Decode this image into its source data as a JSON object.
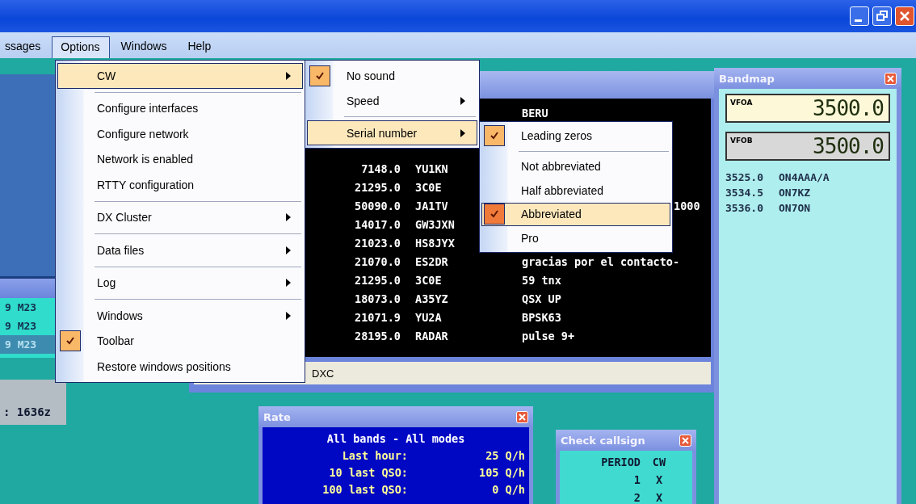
{
  "menu_bar": [
    {
      "label": "ssages",
      "selected": false
    },
    {
      "label": "Options",
      "selected": true
    },
    {
      "label": "Windows",
      "selected": false
    },
    {
      "label": "Help",
      "selected": false
    }
  ],
  "options_menu": [
    {
      "label": "CW",
      "kind": "submenu",
      "checked": false,
      "selected": true
    },
    {
      "kind": "separator"
    },
    {
      "label": "Configure interfaces",
      "kind": "item",
      "checked": false,
      "selected": false
    },
    {
      "label": "Configure network",
      "kind": "item",
      "checked": false,
      "selected": false
    },
    {
      "label": "Network is enabled",
      "kind": "item",
      "checked": false,
      "selected": false
    },
    {
      "label": "RTTY configuration",
      "kind": "item",
      "checked": false,
      "selected": false
    },
    {
      "kind": "separator"
    },
    {
      "label": "DX Cluster",
      "kind": "submenu",
      "checked": false,
      "selected": false
    },
    {
      "kind": "separator"
    },
    {
      "label": "Data files",
      "kind": "submenu",
      "checked": false,
      "selected": false
    },
    {
      "kind": "separator"
    },
    {
      "label": "Log",
      "kind": "submenu",
      "checked": false,
      "selected": false
    },
    {
      "kind": "separator"
    },
    {
      "label": "Windows",
      "kind": "submenu",
      "checked": false,
      "selected": false
    },
    {
      "label": "Toolbar",
      "kind": "item",
      "checked": true,
      "selected": false
    },
    {
      "label": "Restore windows positions",
      "kind": "item",
      "checked": false,
      "selected": false
    }
  ],
  "cw_submenu": [
    {
      "label": "No sound",
      "kind": "item",
      "checked": true,
      "selected": false
    },
    {
      "label": "Speed",
      "kind": "submenu",
      "checked": false,
      "selected": false
    },
    {
      "kind": "separator"
    },
    {
      "label": "Serial number",
      "kind": "submenu",
      "checked": false,
      "selected": true
    }
  ],
  "serial_submenu": [
    {
      "label": "Leading zeros",
      "kind": "item",
      "checked": true,
      "selected": false
    },
    {
      "kind": "separator"
    },
    {
      "label": "Not abbreviated",
      "kind": "item",
      "checked": false,
      "selected": false
    },
    {
      "label": "Half abbreviated",
      "kind": "item",
      "checked": false,
      "selected": false
    },
    {
      "label": "Abbreviated",
      "kind": "item",
      "checked": true,
      "selected": true
    },
    {
      "label": "Pro",
      "kind": "item",
      "checked": false,
      "selected": false
    }
  ],
  "log_window": {
    "rows": [
      {
        "text": "9 M23",
        "selected": false
      },
      {
        "text": "9 M23",
        "selected": false
      },
      {
        "text": "9 M23",
        "selected": true
      }
    ]
  },
  "time_panel": {
    "text": ": 1636z"
  },
  "dx_cluster": {
    "rows": [
      {
        "comment": "BERU"
      },
      {
        "freq": "7148.0",
        "call": "YU1KN"
      },
      {
        "freq": "21295.0",
        "call": "3C0E"
      },
      {
        "freq": "50090.0",
        "call": "JA1TV",
        "trailing": "1000"
      },
      {
        "freq": "14017.0",
        "call": "GW3JXN"
      },
      {
        "freq": "21023.0",
        "call": "HS8JYX"
      },
      {
        "freq": "21070.0",
        "call": "ES2DR",
        "comment": "gracias por el contacto-"
      },
      {
        "freq": "21295.0",
        "call": "3C0E",
        "comment": "59 tnx"
      },
      {
        "freq": "18073.0",
        "call": "A35YZ",
        "comment": "QSX UP"
      },
      {
        "freq": "21071.9",
        "call": "YU2A",
        "comment": "BPSK63"
      },
      {
        "freq": "28195.0",
        "call": "RADAR",
        "comment": "pulse 9+"
      }
    ],
    "status_tab": "DXC"
  },
  "bandmap": {
    "title": "Bandmap",
    "vfos": [
      {
        "label": "VFOA",
        "value": "3500.0",
        "selected": true
      },
      {
        "label": "VFOB",
        "value": "3500.0",
        "selected": false
      }
    ],
    "spots": [
      {
        "freq": "3525.0",
        "call": "ON4AAA/A"
      },
      {
        "freq": "3534.5",
        "call": "ON7KZ"
      },
      {
        "freq": "3536.0",
        "call": "ON7ON"
      }
    ]
  },
  "rate": {
    "title": "Rate",
    "heading": "All bands - All modes",
    "rows": [
      {
        "label": "Last hour:",
        "value": "25 Q/h"
      },
      {
        "label": "10 last QSO:",
        "value": "105 Q/h"
      },
      {
        "label": "100 last QSO:",
        "value": "0 Q/h"
      }
    ]
  },
  "check_callsign": {
    "title": "Check callsign",
    "columns": [
      "PERIOD",
      "CW"
    ],
    "rows": [
      [
        "1",
        "X"
      ],
      [
        "2",
        "X"
      ]
    ]
  }
}
